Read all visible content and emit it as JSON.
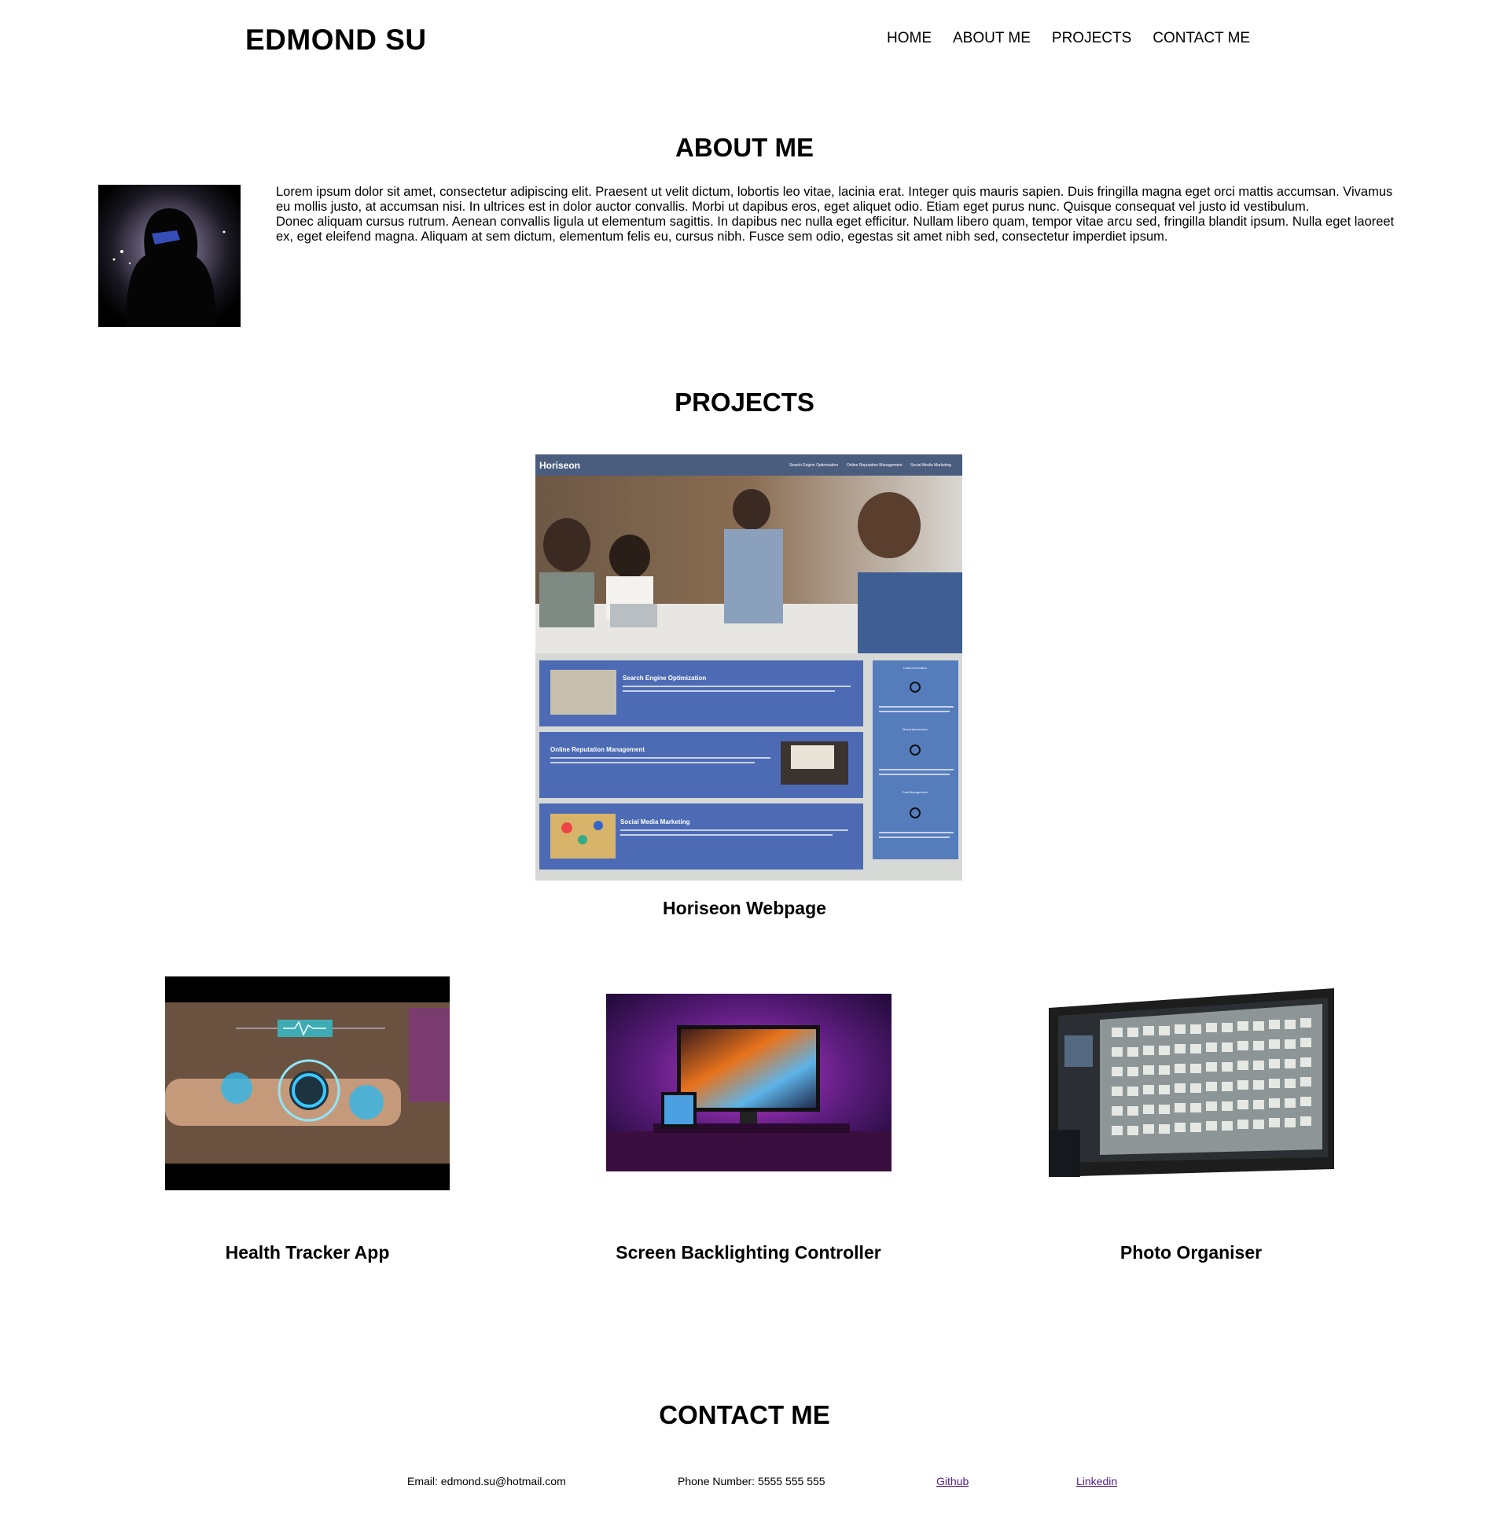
{
  "header": {
    "title": "EDMOND SU",
    "nav": [
      "HOME",
      "ABOUT ME",
      "PROJECTS",
      "CONTACT ME"
    ]
  },
  "about": {
    "heading": "ABOUT ME",
    "paragraph_1": "Lorem ipsum dolor sit amet, consectetur adipiscing elit. Praesent ut velit dictum, lobortis leo vitae, lacinia erat. Integer quis mauris sapien. Duis fringilla magna eget orci mattis accumsan. Vivamus eu mollis justo, at accumsan nisi. In ultrices est in dolor auctor convallis. Morbi ut dapibus eros, eget aliquet odio. Etiam eget purus nunc. Quisque consequat vel justo id vestibulum.",
    "paragraph_2": "Donec aliquam cursus rutrum. Aenean convallis ligula ut elementum sagittis. In dapibus nec nulla eget efficitur. Nullam libero quam, tempor vitae arcu sed, fringilla blandit ipsum. Nulla eget laoreet ex, eget eleifend magna. Aliquam at sem dictum, elementum felis eu, cursus nibh. Fusce sem odio, egestas sit amet nibh sed, consectetur imperdiet ipsum."
  },
  "projects": {
    "heading": "PROJECTS",
    "featured": {
      "caption": "Horiseon Webpage",
      "screenshot": {
        "brand": "Horiseon",
        "nav": [
          "Search Engine Optimization",
          "Online Reputation Management",
          "Social Media Marketing"
        ],
        "cards": [
          "Search Engine Optimization",
          "Online Reputation Management",
          "Social Media Marketing"
        ],
        "side_items": [
          "Lead Generation",
          "Brand Awareness",
          "Cost Management"
        ]
      }
    },
    "items": [
      {
        "caption": "Health Tracker App"
      },
      {
        "caption": "Screen Backlighting Controller"
      },
      {
        "caption": "Photo Organiser"
      }
    ]
  },
  "contact": {
    "heading": "CONTACT ME",
    "email": "Email: edmond.su@hotmail.com",
    "phone": "Phone Number: 5555 555 555",
    "github": "Github",
    "linkedin": "Linkedin"
  },
  "colors": {
    "link_visited": "#551a8b",
    "horiseon_header": "#4b5d7f",
    "horiseon_card": "#4c6bb4",
    "horiseon_side": "#557cbb"
  }
}
